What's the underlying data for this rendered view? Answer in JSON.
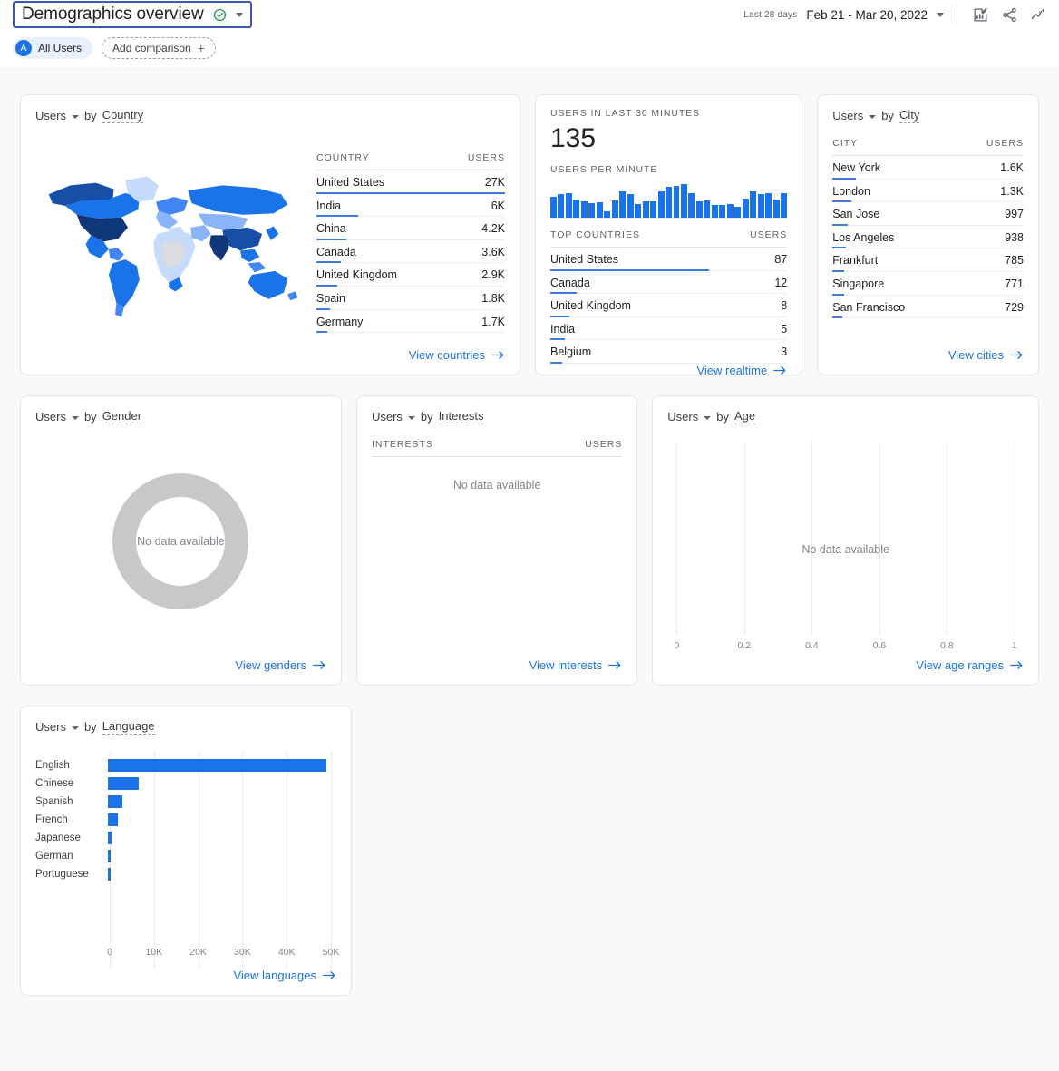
{
  "header": {
    "title": "Demographics overview",
    "check_icon": "verified-check-icon",
    "title_caret_icon": "chevron-down-icon",
    "date_label": "Last 28 days",
    "date_value": "Feb 21 - Mar 20, 2022",
    "date_caret_icon": "chevron-down-icon",
    "icons": [
      {
        "name": "edit-comparison-icon"
      },
      {
        "name": "share-icon"
      },
      {
        "name": "insights-icon"
      }
    ]
  },
  "chips": {
    "all_users_avatar": "A",
    "all_users_label": "All Users",
    "add_comparison_label": "Add comparison",
    "add_comparison_icon": "plus-icon"
  },
  "colors": {
    "accent_blue": "#1a73e8",
    "bar_blue": "#3c7ddb",
    "donut_gray": "#c8c8c8",
    "canvas": "#f8f9fa",
    "focus_outline": "#4054b2",
    "check_green": "#1e8e3e"
  },
  "cards": {
    "country": {
      "metric": "Users",
      "by": "by",
      "dimension": "Country",
      "col_dimension": "COUNTRY",
      "col_metric": "USERS",
      "link": "View countries",
      "rows": [
        {
          "label": "United States",
          "value": "27K",
          "pct": 100
        },
        {
          "label": "India",
          "value": "6K",
          "pct": 22
        },
        {
          "label": "China",
          "value": "4.2K",
          "pct": 16
        },
        {
          "label": "Canada",
          "value": "3.6K",
          "pct": 13
        },
        {
          "label": "United Kingdom",
          "value": "2.9K",
          "pct": 11
        },
        {
          "label": "Spain",
          "value": "1.8K",
          "pct": 7
        },
        {
          "label": "Germany",
          "value": "1.7K",
          "pct": 6
        }
      ]
    },
    "realtime": {
      "headline_label": "USERS IN LAST 30 MINUTES",
      "headline_value": "135",
      "per_minute_label": "USERS PER MINUTE",
      "col_dimension": "TOP COUNTRIES",
      "col_metric": "USERS",
      "link": "View realtime",
      "sparkline": [
        62,
        70,
        72,
        55,
        50,
        42,
        45,
        20,
        52,
        78,
        70,
        40,
        48,
        50,
        78,
        92,
        95,
        100,
        72,
        50,
        52,
        38,
        38,
        40,
        32,
        58,
        78,
        70,
        72,
        55,
        72
      ],
      "rows": [
        {
          "label": "United States",
          "value": "87",
          "pct": 100
        },
        {
          "label": "Canada",
          "value": "12",
          "pct": 29
        },
        {
          "label": "United Kingdom",
          "value": "8",
          "pct": 20
        },
        {
          "label": "India",
          "value": "5",
          "pct": 14
        },
        {
          "label": "Belgium",
          "value": "3",
          "pct": 9
        }
      ]
    },
    "city": {
      "metric": "Users",
      "by": "by",
      "dimension": "City",
      "col_dimension": "CITY",
      "col_metric": "USERS",
      "link": "View cities",
      "rows": [
        {
          "label": "New York",
          "value": "1.6K",
          "pct": 12
        },
        {
          "label": "London",
          "value": "1.3K",
          "pct": 10
        },
        {
          "label": "San Jose",
          "value": "997",
          "pct": 8
        },
        {
          "label": "Los Angeles",
          "value": "938",
          "pct": 7
        },
        {
          "label": "Frankfurt",
          "value": "785",
          "pct": 6
        },
        {
          "label": "Singapore",
          "value": "771",
          "pct": 6
        },
        {
          "label": "San Francisco",
          "value": "729",
          "pct": 5
        }
      ]
    },
    "gender": {
      "metric": "Users",
      "by": "by",
      "dimension": "Gender",
      "no_data": "No data available",
      "link": "View genders"
    },
    "interests": {
      "metric": "Users",
      "by": "by",
      "dimension": "Interests",
      "col_dimension": "INTERESTS",
      "col_metric": "USERS",
      "no_data": "No data available",
      "link": "View interests"
    },
    "age": {
      "metric": "Users",
      "by": "by",
      "dimension": "Age",
      "no_data": "No data available",
      "link": "View age ranges"
    },
    "language": {
      "metric": "Users",
      "by": "by",
      "dimension": "Language",
      "link": "View languages"
    }
  },
  "chart_data": [
    {
      "type": "bar",
      "id": "users-by-language",
      "title": "Users by Language",
      "orientation": "horizontal",
      "categories": [
        "English",
        "Chinese",
        "Spanish",
        "French",
        "Japanese",
        "German",
        "Portuguese"
      ],
      "values": [
        49000,
        7000,
        3200,
        2200,
        900,
        700,
        700
      ],
      "xlabel": "",
      "ylabel": "",
      "xlim": [
        0,
        50000
      ],
      "xticks": [
        0,
        10000,
        20000,
        30000,
        40000,
        50000
      ],
      "xticklabels": [
        "0",
        "10K",
        "20K",
        "30K",
        "40K",
        "50K"
      ],
      "grid": true,
      "legend": "none"
    },
    {
      "type": "bar",
      "id": "users-per-minute",
      "title": "Users per minute",
      "orientation": "vertical",
      "categories": [
        "-30",
        "-29",
        "-28",
        "-27",
        "-26",
        "-25",
        "-24",
        "-23",
        "-22",
        "-21",
        "-20",
        "-19",
        "-18",
        "-17",
        "-16",
        "-15",
        "-14",
        "-13",
        "-12",
        "-11",
        "-10",
        "-9",
        "-8",
        "-7",
        "-6",
        "-5",
        "-4",
        "-3",
        "-2",
        "-1",
        "0"
      ],
      "values": [
        62,
        70,
        72,
        55,
        50,
        42,
        45,
        20,
        52,
        78,
        70,
        40,
        48,
        50,
        78,
        92,
        95,
        100,
        72,
        50,
        52,
        38,
        38,
        40,
        32,
        58,
        78,
        70,
        72,
        55,
        72
      ],
      "xlabel": "",
      "ylabel": "",
      "grid": false,
      "legend": "none"
    },
    {
      "type": "bar",
      "id": "users-by-country",
      "title": "Users by Country",
      "orientation": "horizontal",
      "categories": [
        "United States",
        "India",
        "China",
        "Canada",
        "United Kingdom",
        "Spain",
        "Germany"
      ],
      "values": [
        27000,
        6000,
        4200,
        3600,
        2900,
        1800,
        1700
      ],
      "xlabel": "",
      "ylabel": "USERS",
      "grid": false,
      "legend": "none"
    },
    {
      "type": "bar",
      "id": "users-by-city",
      "title": "Users by City",
      "orientation": "horizontal",
      "categories": [
        "New York",
        "London",
        "San Jose",
        "Los Angeles",
        "Frankfurt",
        "Singapore",
        "San Francisco"
      ],
      "values": [
        1600,
        1300,
        997,
        938,
        785,
        771,
        729
      ],
      "xlabel": "",
      "ylabel": "USERS",
      "grid": false,
      "legend": "none"
    },
    {
      "type": "bar",
      "id": "realtime-top-countries",
      "title": "Top countries (last 30 minutes)",
      "orientation": "horizontal",
      "categories": [
        "United States",
        "Canada",
        "United Kingdom",
        "India",
        "Belgium"
      ],
      "values": [
        87,
        12,
        8,
        5,
        3
      ],
      "xlabel": "",
      "ylabel": "USERS",
      "grid": false,
      "legend": "none"
    },
    {
      "type": "pie",
      "id": "users-by-gender",
      "title": "Users by Gender",
      "labels": [],
      "values": [],
      "annotation": "No data available",
      "legend": "none"
    },
    {
      "type": "bar",
      "id": "users-by-age",
      "title": "Users by Age",
      "orientation": "horizontal",
      "categories": [],
      "values": [],
      "annotation": "No data available",
      "xlim": [
        0,
        1
      ],
      "xticks": [
        0,
        0.2,
        0.4,
        0.6,
        0.8,
        1
      ],
      "xticklabels": [
        "0",
        "0.2",
        "0.4",
        "0.6",
        "0.8",
        "1"
      ],
      "grid": true,
      "legend": "none"
    }
  ]
}
